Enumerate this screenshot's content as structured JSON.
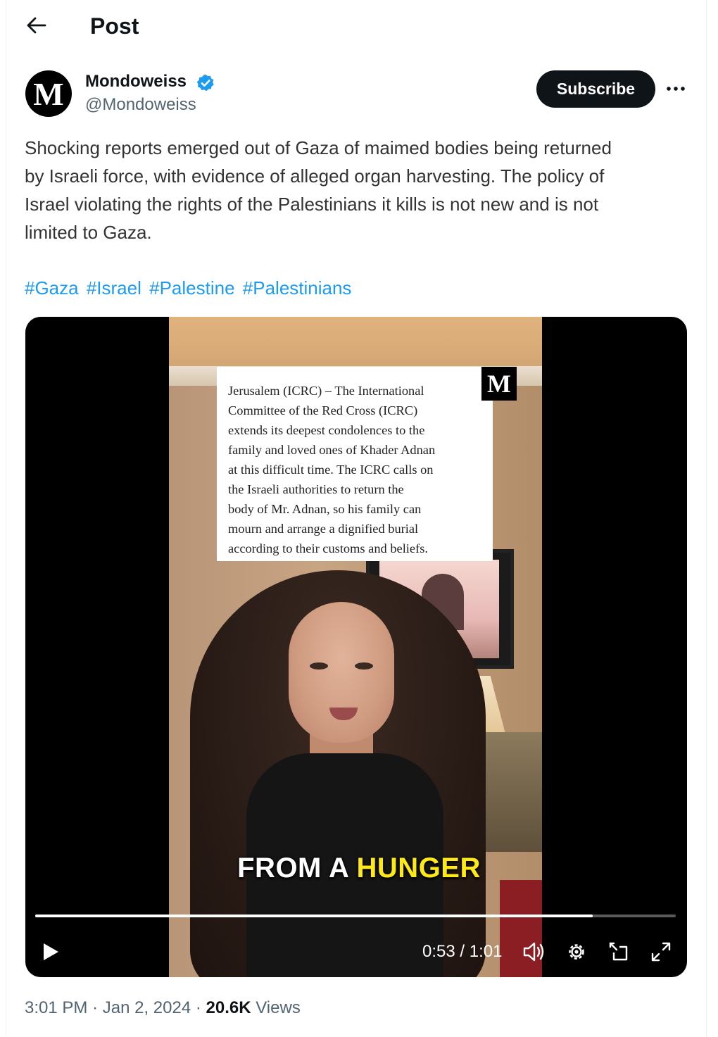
{
  "header": {
    "title": "Post",
    "back_icon": "arrow-left-icon"
  },
  "author": {
    "avatar_letter": "M",
    "display_name": "Mondoweiss",
    "handle": "@Mondoweiss",
    "verified": true,
    "subscribe_label": "Subscribe",
    "more_icon": "more-horizontal-icon"
  },
  "post": {
    "text": "Shocking reports emerged out of Gaza of maimed bodies being returned\nby Israeli force, with evidence of alleged organ harvesting. The policy of\nIsrael violating the rights of the Palestinians it kills is not new and is not\nlimited to Gaza.",
    "hashtags": [
      "#Gaza",
      "#Israel",
      "#Palestine",
      "#Palestinians"
    ]
  },
  "video": {
    "overlay_text": "Jerusalem (ICRC) – The International\nCommittee of the Red Cross (ICRC)\nextends its deepest condolences to the\nfamily and loved ones of Khader Adnan\nat this difficult time. The ICRC calls on\nthe Israeli authorities to return the\nbody of Mr. Adnan, so his family can\nmourn and arrange a dignified burial\naccording to their customs and beliefs.",
    "overlay_logo": "M",
    "caption_white": "FROM A ",
    "caption_yellow": "HUNGER",
    "current_time": "0:53",
    "duration": "1:01",
    "time_display": "0:53 / 1:01",
    "progress": 0.87,
    "controls": {
      "play_icon": "play-icon",
      "volume_icon": "volume-icon",
      "settings_icon": "settings-gear-icon",
      "pip_icon": "picture-in-picture-icon",
      "fullscreen_icon": "fullscreen-icon"
    }
  },
  "meta": {
    "time": "3:01 PM",
    "date": "Jan 2, 2024",
    "separator": "·",
    "views_count": "20.6K",
    "views_label": "Views"
  },
  "colors": {
    "link": "#1d9bf0",
    "verified": "#1d9bf0",
    "caption_highlight": "#ffe817",
    "button_bg": "#0f1419"
  }
}
